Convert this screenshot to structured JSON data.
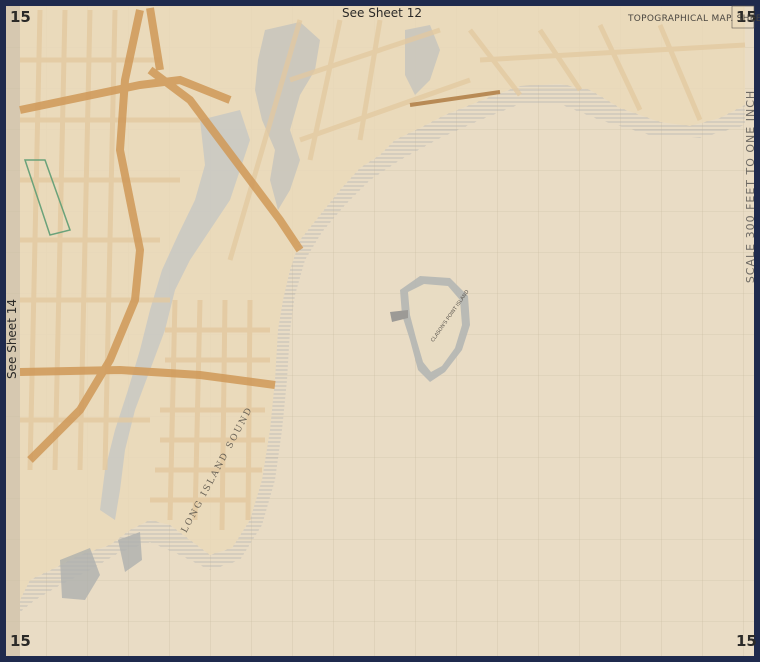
{
  "map": {
    "sheet_number": "15",
    "see_sheet_top": "See Sheet 12",
    "see_sheet_left": "See Sheet 14",
    "title": "TOPOGRAPHICAL MAP. SHEET 15.",
    "scale": "SCALE 300 FEET TO ONE INCH",
    "water_label": "LONG ISLAND SOUND",
    "island_label": "CLASON'S POINT ISLAND",
    "colors": {
      "paper": "#e9dcc5",
      "water_hatch": "#b9bcc0",
      "road_orange": "#d4a066",
      "road_dark": "#c17f3f",
      "border": "#1f2a4d"
    }
  }
}
